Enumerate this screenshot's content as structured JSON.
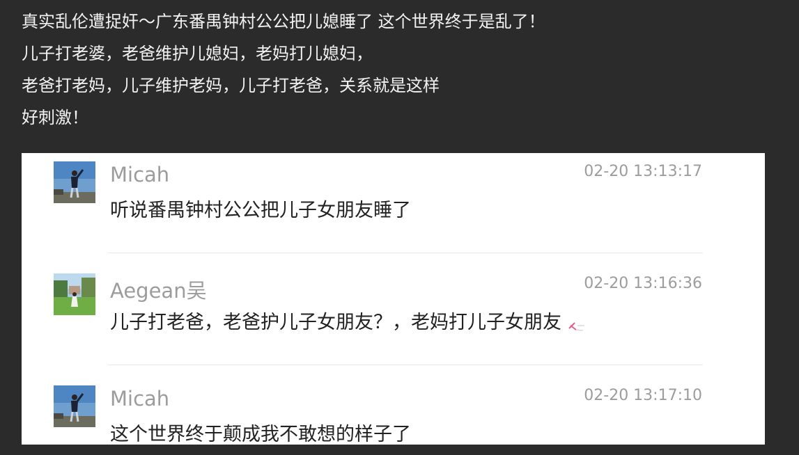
{
  "post": {
    "lines": [
      "真实乱伦遭捉奸～广东番禺钟村公公把儿媳睡了 这个世界终于是乱了！",
      "儿子打老婆，老爸维护儿媳妇，老妈打儿媳妇，",
      "老爸打老妈，儿子维护老妈，儿子打老爸，关系就是这样",
      "好刺激！"
    ]
  },
  "comments": [
    {
      "avatar_icon": "user-avatar-photo",
      "username": "Micah",
      "timestamp": "02-20 13:13:17",
      "message": "听说番禺钟村公公把儿子女朋友睡了"
    },
    {
      "avatar_icon": "user-avatar-photo",
      "username": "Aegean吴",
      "timestamp": "02-20 13:16:36",
      "message": "儿子打老爸，老爸护儿子女朋友？，老妈打儿子女朋友"
    },
    {
      "avatar_icon": "user-avatar-photo",
      "username": "Micah",
      "timestamp": "02-20 13:17:10",
      "message": "这个世界终于颠成我不敢想的样子了"
    }
  ],
  "colors": {
    "background": "#2b2b2b",
    "post_text": "#f2f2f2",
    "card_background": "#ffffff",
    "meta_text": "#9c9c9c",
    "message_text": "#222222"
  }
}
